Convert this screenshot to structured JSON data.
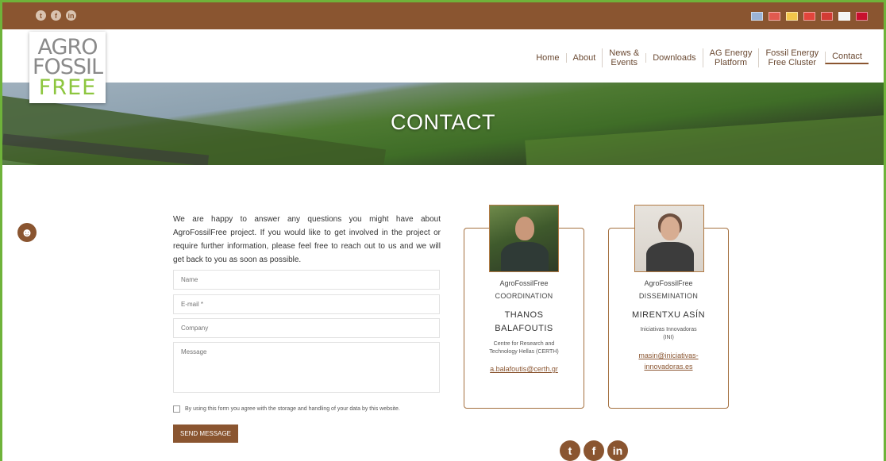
{
  "topbar": {
    "social": [
      {
        "icon": "twitter-icon",
        "glyph": "t"
      },
      {
        "icon": "facebook-icon",
        "glyph": "f"
      },
      {
        "icon": "linkedin-icon",
        "glyph": "in"
      }
    ],
    "flags": [
      {
        "icon": "flag-icon",
        "color": "#9bb3d6"
      },
      {
        "icon": "flag-icon",
        "color": "#e05a4f"
      },
      {
        "icon": "flag-icon",
        "color": "#f3c64b"
      },
      {
        "icon": "flag-icon",
        "color": "#e2453c"
      },
      {
        "icon": "flag-icon",
        "color": "#d23b34"
      },
      {
        "icon": "flag-icon",
        "color": "#f4f4f4"
      },
      {
        "icon": "flag-icon",
        "color": "#c8102e"
      }
    ]
  },
  "logo": {
    "line1": "AGRO",
    "line2": "FOSSIL",
    "line3": "FREE"
  },
  "nav": {
    "items": [
      {
        "label": "Home"
      },
      {
        "label": "About"
      },
      {
        "line1": "News &",
        "line2": "Events"
      },
      {
        "label": "Downloads"
      },
      {
        "line1": "AG Energy",
        "line2": "Platform"
      },
      {
        "line1": "Fossil Energy",
        "line2": "Free Cluster"
      },
      {
        "label": "Contact",
        "active": true
      }
    ]
  },
  "hero": {
    "title": "CONTACT"
  },
  "intro": "We are happy to answer any questions you might have about AgroFossilFree project. If you would like to get involved in the project or require further information, please feel free to reach out to us and we will get back to you as soon as possible.",
  "form": {
    "name_placeholder": "Name",
    "email_placeholder": "E-mail *",
    "company_placeholder": "Company",
    "message_placeholder": "Message",
    "consent": "By using this form you agree with the storage and handling of your data by this website.",
    "send": "SEND MESSAGE"
  },
  "contacts": [
    {
      "org": "AgroFossilFree",
      "role": "COORDINATION",
      "name_line1": "THANOS",
      "name_line2": "BALAFOUTIS",
      "inst_line1": "Centre for Research and",
      "inst_line2": "Technology Hellas (CERTH)",
      "email": "a.balafoutis@certh.gr"
    },
    {
      "org": "AgroFossilFree",
      "role": "DISSEMINATION",
      "name": "MIRENTXU ASÍN",
      "inst_line1": "Iniciativas Innovadoras",
      "inst_line2": "(INI)",
      "email_line1": "masin@iniciativas-",
      "email_line2": "innovadoras.es"
    }
  ],
  "footer_social": [
    {
      "icon": "twitter-icon",
      "glyph": "t"
    },
    {
      "icon": "facebook-icon",
      "glyph": "f"
    },
    {
      "icon": "linkedin-icon",
      "glyph": "in"
    }
  ],
  "colors": {
    "brand_brown": "#8a5530",
    "frame_green": "#6fb33a",
    "logo_green": "#8dc63f"
  }
}
